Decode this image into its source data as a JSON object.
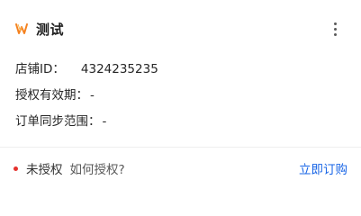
{
  "header": {
    "title": "测试",
    "logo_icon": "brand-w-logo",
    "more_icon": "more-vertical-icon"
  },
  "store": {
    "id_label": "店铺ID：",
    "id_value": "4324235235",
    "auth_period_label": "授权有效期：",
    "auth_period_value": "-",
    "sync_range_label": "订单同步范围：",
    "sync_range_value": "-"
  },
  "footer": {
    "status_label": "未授权",
    "status_color": "#e5322d",
    "how_to_label": "如何授权?",
    "buy_label": "立即订购",
    "accent_color": "#1764e6"
  }
}
